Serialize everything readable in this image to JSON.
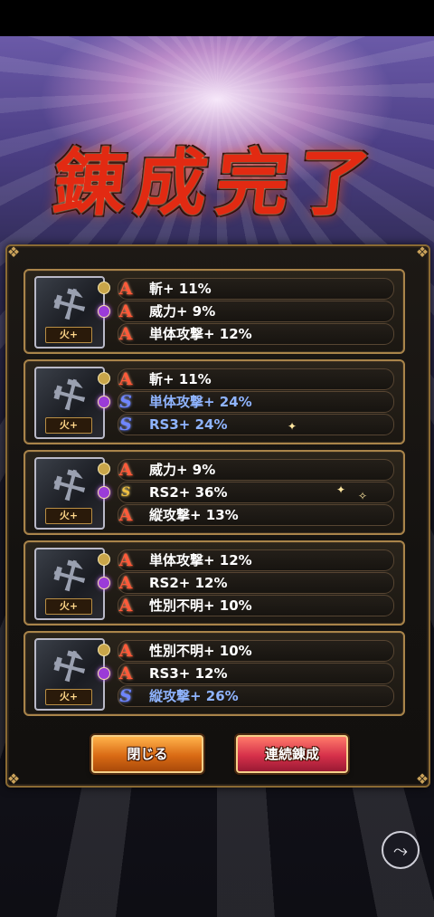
{
  "title": "錬成完了",
  "cards": [
    {
      "element_tag": "火+",
      "rows": [
        {
          "rank": "A",
          "rank_icon": "rank-a-icon",
          "text": "斬+ 11%"
        },
        {
          "rank": "A",
          "rank_icon": "rank-a-icon",
          "text": "威力+ 9%"
        },
        {
          "rank": "A",
          "rank_icon": "rank-a-icon",
          "text": "単体攻撃+ 12%"
        }
      ]
    },
    {
      "element_tag": "火+",
      "rows": [
        {
          "rank": "A",
          "rank_icon": "rank-a-icon",
          "text": "斬+ 11%"
        },
        {
          "rank": "S",
          "rank_icon": "rank-s-icon",
          "text": "単体攻撃+ 24%"
        },
        {
          "rank": "S",
          "rank_icon": "rank-s-icon",
          "text": "RS3+ 24%"
        }
      ]
    },
    {
      "element_tag": "火+",
      "rows": [
        {
          "rank": "A",
          "rank_icon": "rank-a-icon",
          "text": "威力+ 9%"
        },
        {
          "rank": "SS",
          "rank_icon": "rank-ss-icon",
          "text": "RS2+ 36%"
        },
        {
          "rank": "A",
          "rank_icon": "rank-a-icon",
          "text": "縦攻撃+ 13%"
        }
      ]
    },
    {
      "element_tag": "火+",
      "rows": [
        {
          "rank": "A",
          "rank_icon": "rank-a-icon",
          "text": "単体攻撃+ 12%"
        },
        {
          "rank": "A",
          "rank_icon": "rank-a-icon",
          "text": "RS2+ 12%"
        },
        {
          "rank": "A",
          "rank_icon": "rank-a-icon",
          "text": "性別不明+ 10%"
        }
      ]
    },
    {
      "element_tag": "火+",
      "rows": [
        {
          "rank": "A",
          "rank_icon": "rank-a-icon",
          "text": "性別不明+ 10%"
        },
        {
          "rank": "A",
          "rank_icon": "rank-a-icon",
          "text": "RS3+ 12%"
        },
        {
          "rank": "S",
          "rank_icon": "rank-s-icon",
          "text": "縦攻撃+ 26%"
        }
      ]
    }
  ],
  "buttons": {
    "close_label": "閉じる",
    "continue_label": "連続錬成"
  },
  "share_icon": "share-icon",
  "colors": {
    "rank_a": "#ff5a3a",
    "rank_s": "#6f86ff",
    "rank_ss": "#f0c040",
    "title": "#e22a12",
    "frame_gold": "#a9844a"
  }
}
